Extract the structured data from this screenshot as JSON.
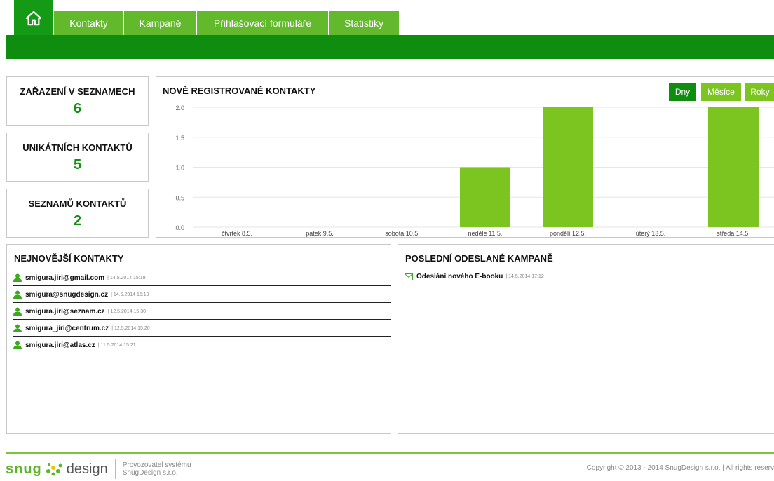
{
  "nav": {
    "tabs": [
      {
        "label": "Kontakty"
      },
      {
        "label": "Kampaně"
      },
      {
        "label": "Přihlašovací formuláře"
      },
      {
        "label": "Statistiky"
      }
    ]
  },
  "stats": [
    {
      "label": "ZAŘAZENÍ V SEZNAMECH",
      "value": "6"
    },
    {
      "label": "UNIKÁTNÍCH KONTAKTŮ",
      "value": "5"
    },
    {
      "label": "SEZNAMŮ KONTAKTŮ",
      "value": "2"
    }
  ],
  "chart_panel": {
    "title": "NOVĚ REGISTROVANÉ KONTAKTY",
    "buttons": [
      {
        "label": "Dny",
        "active": true
      },
      {
        "label": "Měsíce",
        "active": false
      },
      {
        "label": "Roky",
        "active": false
      }
    ]
  },
  "chart_data": {
    "type": "bar",
    "title": "NOVĚ REGISTROVANÉ KONTAKTY",
    "categories": [
      "čtvrtek 8.5.",
      "pátek 9.5.",
      "sobota 10.5.",
      "neděle 11.5.",
      "pondělí 12.5.",
      "úterý 13.5.",
      "středa 14.5."
    ],
    "values": [
      0,
      0,
      0,
      1,
      2,
      0,
      2
    ],
    "ylim": [
      0,
      2
    ],
    "yticks": [
      "0.0",
      "0.5",
      "1.0",
      "1.5",
      "2.0"
    ],
    "grid": true,
    "bar_color": "#7cc520"
  },
  "contacts_panel": {
    "title": "NEJNOVĚJŠÍ KONTAKTY",
    "items": [
      {
        "email": "smigura.jiri@gmail.com",
        "meta": "| 14.5.2014 15:19"
      },
      {
        "email": "smigura@snugdesign.cz",
        "meta": "| 14.5.2014 15:19"
      },
      {
        "email": "smigura.jiri@seznam.cz",
        "meta": "| 12.5.2014 15:30"
      },
      {
        "email": "smigura_jiri@centrum.cz",
        "meta": "| 12.5.2014 15:20"
      },
      {
        "email": "smigura.jiri@atlas.cz",
        "meta": "| 11.5.2014 15:21"
      }
    ]
  },
  "campaigns_panel": {
    "title": "POSLEDNÍ ODESLANÉ KAMPANĚ",
    "items": [
      {
        "name": "Odeslání nového E-booku",
        "meta": "| 14.5.2014 17:12"
      }
    ]
  },
  "footer": {
    "logo_snug": "snug",
    "logo_design": "design",
    "sub_line1": "Provozovatel systému",
    "sub_line2": "SnugDesign s.r.o.",
    "copyright": "Copyright © 2013 - 2014 SnugDesign s.r.o. | All rights reserv"
  },
  "colors": {
    "dark_green": "#0f8d0f",
    "light_green": "#62b92c",
    "bar_green": "#7cc520",
    "value_green": "#119011"
  }
}
